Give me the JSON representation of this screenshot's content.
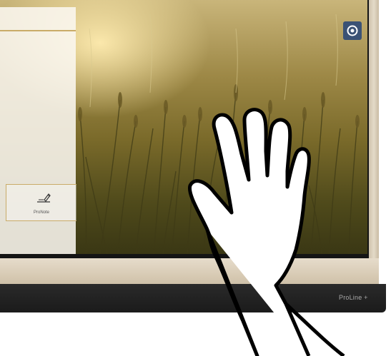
{
  "display": {
    "brand_label": "ProLine +"
  },
  "side_panel": {
    "tile": {
      "label": "ProNote",
      "icon": "pen-note-icon"
    }
  },
  "screen": {
    "background": "wheat-field-photo",
    "corner_button_icon": "target-icon"
  },
  "colors": {
    "accent_gold": "#c9ab68",
    "badge_blue": "#3b5275",
    "bezel": "#141414",
    "frame": "#ddd2bf"
  }
}
